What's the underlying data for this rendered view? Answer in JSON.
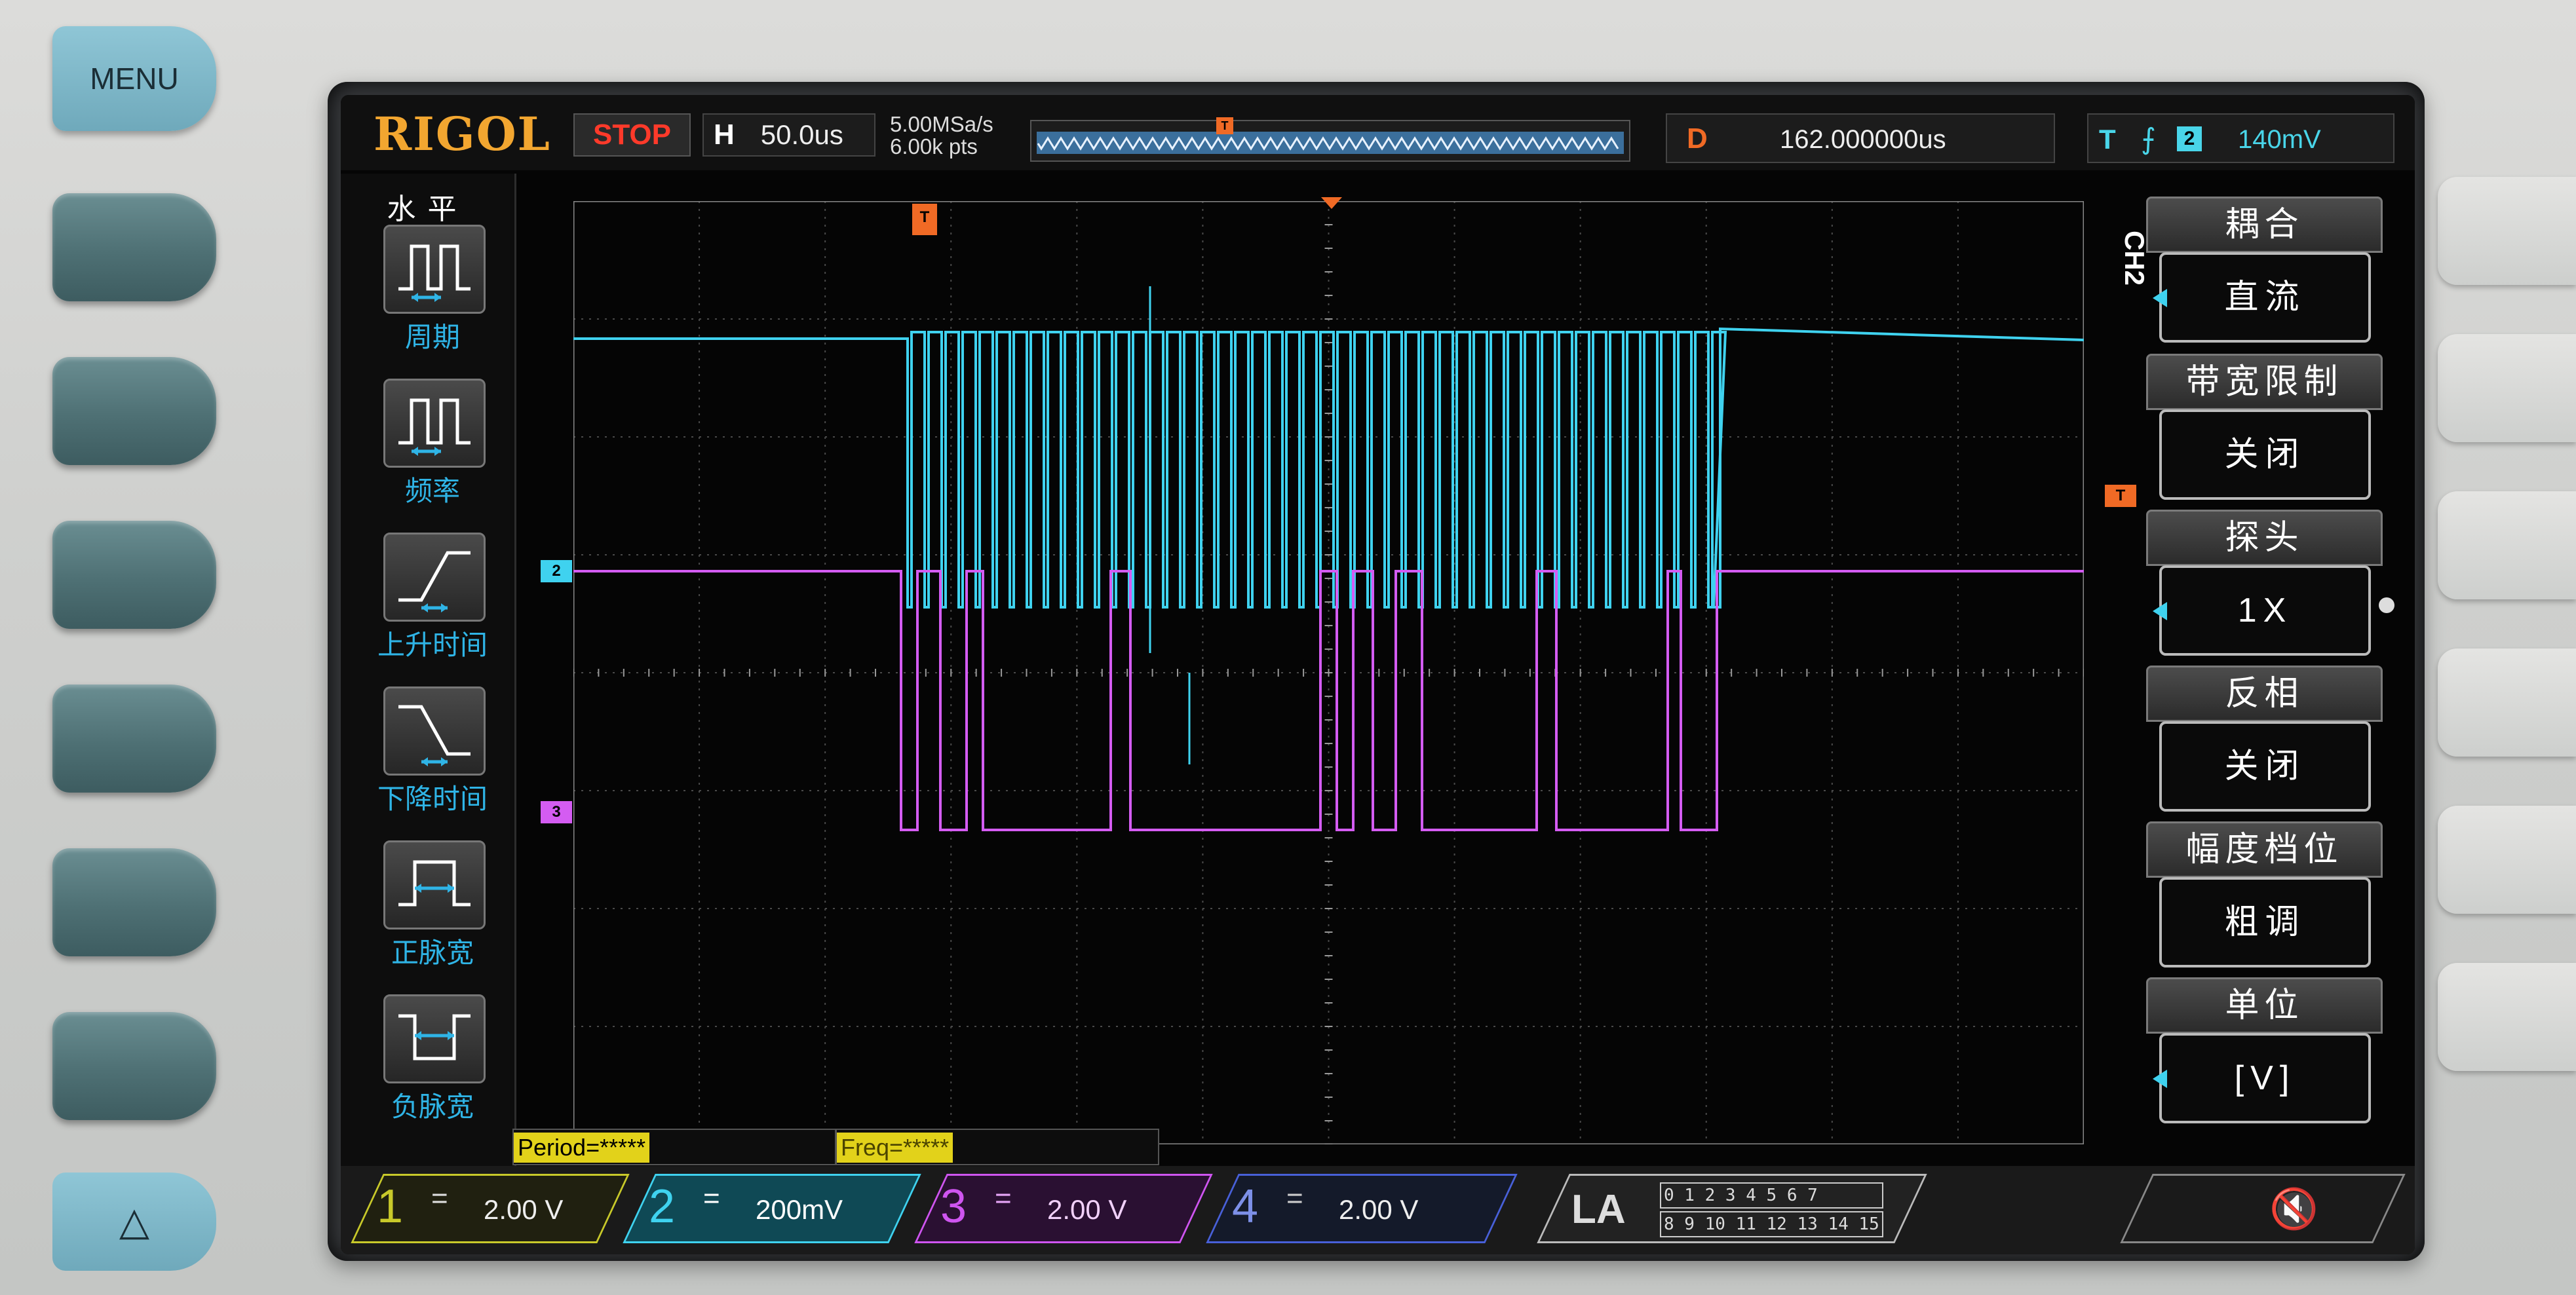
{
  "hardware": {
    "menu_label": "MENU",
    "up_label": "△"
  },
  "topbar": {
    "brand": "RIGOL",
    "run_state": "STOP",
    "timebase_label": "H",
    "timebase_value": "50.0us",
    "sample_rate": "5.00MSa/s",
    "memory_depth": "6.00k pts",
    "trigger_marker": "T",
    "delay_label": "D",
    "delay_value": "162.000000us",
    "trigger_label": "T",
    "trigger_edge": "⨍",
    "trigger_channel": "2",
    "trigger_level": "140mV"
  },
  "left_menu": {
    "title": "水平",
    "items": [
      {
        "label": "周期",
        "icon": "period-icon"
      },
      {
        "label": "频率",
        "icon": "frequency-icon"
      },
      {
        "label": "上升时间",
        "icon": "rise-time-icon"
      },
      {
        "label": "下降时间",
        "icon": "fall-time-icon"
      },
      {
        "label": "正脉宽",
        "icon": "positive-width-icon"
      },
      {
        "label": "负脉宽",
        "icon": "negative-width-icon"
      }
    ]
  },
  "right_menu": {
    "channel_label": "CH2",
    "items": [
      {
        "title": "耦合",
        "value": "直流"
      },
      {
        "title": "带宽限制",
        "value": "关闭"
      },
      {
        "title": "探头",
        "value": "1X"
      },
      {
        "title": "反相",
        "value": "关闭"
      },
      {
        "title": "幅度档位",
        "value": "粗调"
      },
      {
        "title": "单位",
        "value": "[V]"
      }
    ]
  },
  "measurements": {
    "period": "Period=*****",
    "freq": "Freq=*****"
  },
  "channels": [
    {
      "num": "1",
      "coupling": "=",
      "scale": "2.00 V",
      "color": "#c8c92a"
    },
    {
      "num": "2",
      "coupling": "=",
      "scale": "200mV",
      "color": "#3fd2ef"
    },
    {
      "num": "3",
      "coupling": "=",
      "scale": "2.00 V",
      "color": "#cf55f0"
    },
    {
      "num": "4",
      "coupling": "=",
      "scale": "2.00 V",
      "color": "#4860d8"
    }
  ],
  "la": {
    "label": "LA",
    "bits_top": "0 1 2 3  4 5 6 7",
    "bits_bottom": "8 9 10 11 12 13 14 15"
  },
  "markers": {
    "ch2": "2",
    "ch3": "3",
    "trig_level": "T"
  },
  "colors": {
    "ch2_trace": "#3fd2ef",
    "ch3_trace": "#d45cf2",
    "brand": "#f2a630",
    "stop": "#ff3a2a",
    "accent_orange": "#f06a25"
  }
}
